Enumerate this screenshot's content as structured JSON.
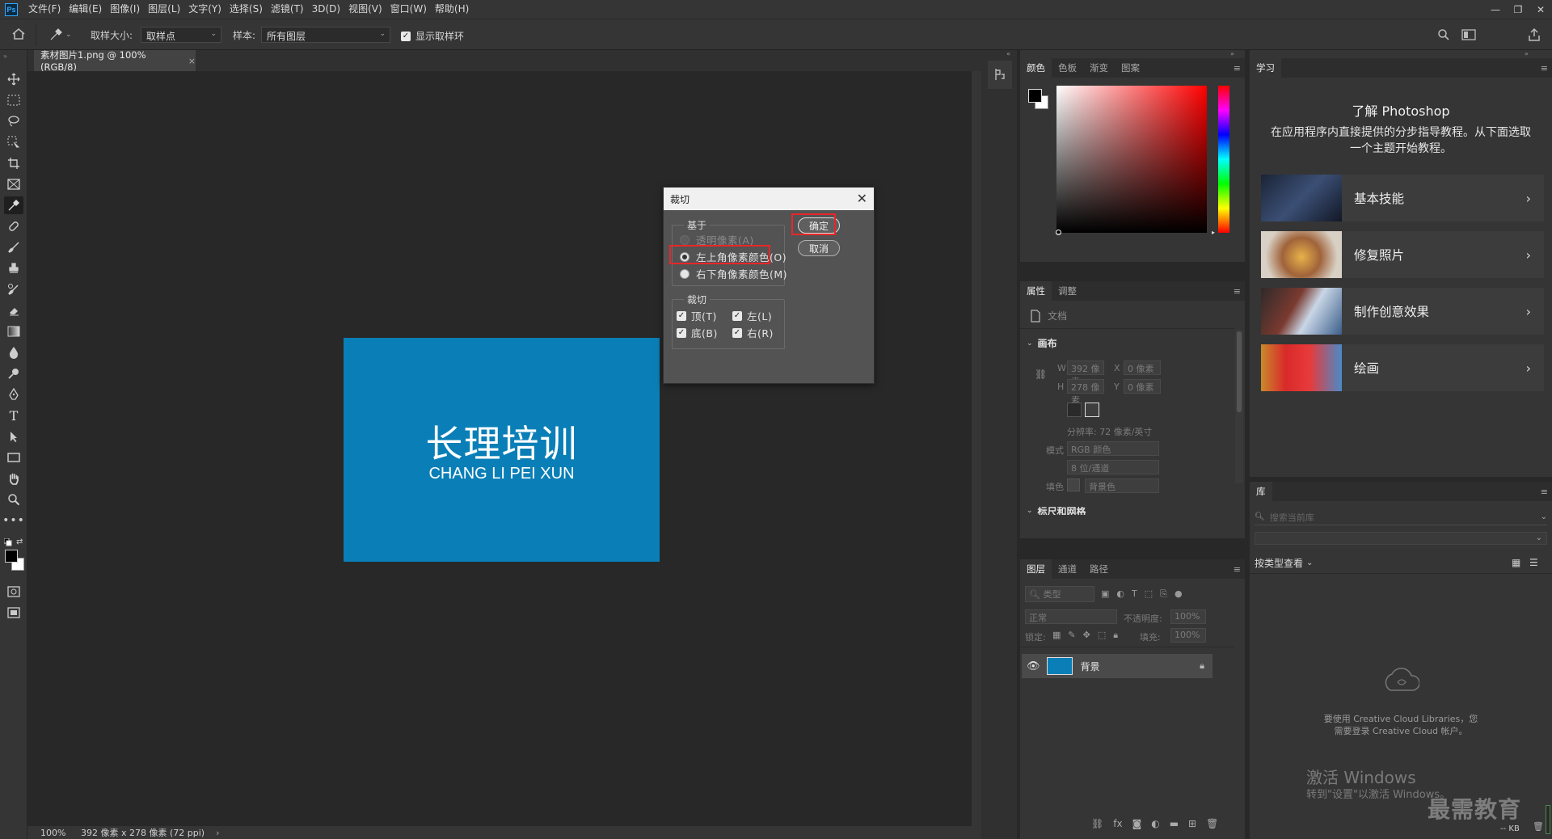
{
  "app": {
    "logo": "Ps"
  },
  "menubar": {
    "items": [
      "文件(F)",
      "编辑(E)",
      "图像(I)",
      "图层(L)",
      "文字(Y)",
      "选择(S)",
      "滤镜(T)",
      "3D(D)",
      "视图(V)",
      "窗口(W)",
      "帮助(H)"
    ]
  },
  "options": {
    "sample_size_label": "取样大小:",
    "sample_size_value": "取样点",
    "sample_label": "样本:",
    "sample_value": "所有图层",
    "show_ring_label": "显示取样环"
  },
  "document": {
    "tab_title": "素材图片1.png @ 100%(RGB/8)",
    "image_title_cn": "长理培训",
    "image_title_en": "CHANG LI PEI XUN",
    "image_color": "#0a7fb7"
  },
  "status": {
    "zoom": "100%",
    "info": "392 像素 x 278 像素 (72 ppi)",
    "arrow": "›"
  },
  "dialog": {
    "title": "裁切",
    "based_on_label": "基于",
    "options": [
      {
        "label": "透明像素(A)",
        "state": "disabled"
      },
      {
        "label": "左上角像素颜色(O)",
        "state": "selected"
      },
      {
        "label": "右下角像素颜色(M)",
        "state": "normal"
      }
    ],
    "trim_label": "裁切",
    "checks": [
      {
        "label": "顶(T)",
        "checked": true
      },
      {
        "label": "左(L)",
        "checked": true
      },
      {
        "label": "底(B)",
        "checked": true
      },
      {
        "label": "右(R)",
        "checked": true
      }
    ],
    "ok": "确定",
    "cancel": "取消"
  },
  "color_panel": {
    "tabs": [
      "颜色",
      "色板",
      "渐变",
      "图案"
    ],
    "hue": "#ff0000"
  },
  "properties_panel": {
    "tabs": [
      "属性",
      "调整"
    ],
    "doc_label": "文档",
    "section": "画布",
    "w_label": "W",
    "w_value": "392 像素",
    "x_label": "X",
    "x_value": "0 像素",
    "h_label": "H",
    "h_value": "278 像素",
    "y_label": "Y",
    "y_value": "0 像素",
    "resolution": "分辨率: 72 像素/英寸",
    "mode_label": "模式",
    "mode_value": "RGB 颜色",
    "depth_value": "8 位/通道",
    "fill_label": "填色",
    "fill_value": "背景色",
    "next_section": "标尺和网格"
  },
  "layers_panel": {
    "tabs": [
      "图层",
      "通道",
      "路径"
    ],
    "filter_placeholder": "类型",
    "blend_mode": "正常",
    "opacity_label": "不透明度:",
    "opacity_value": "100%",
    "lock_label": "锁定:",
    "fill_label": "填充:",
    "fill_value": "100%",
    "layer_name": "背景"
  },
  "learn_panel": {
    "tab": "学习",
    "heading": "了解 Photoshop",
    "desc": "在应用程序内直接提供的分步指导教程。从下面选取一个主题开始教程。",
    "cards": [
      "基本技能",
      "修复照片",
      "制作创意效果",
      "绘画"
    ]
  },
  "library_panel": {
    "tab": "库",
    "search_placeholder": "搜索当前库",
    "view_label": "按类型查看",
    "cc_message_1": "要使用 Creative Cloud Libraries，您",
    "cc_message_2": "需要登录 Creative Cloud 帐户。",
    "size": "-- KB"
  },
  "watermark": {
    "activate_1": "激活 Windows",
    "activate_2": "转到\"设置\"以激活 Windows。",
    "brand": "最需教育"
  }
}
